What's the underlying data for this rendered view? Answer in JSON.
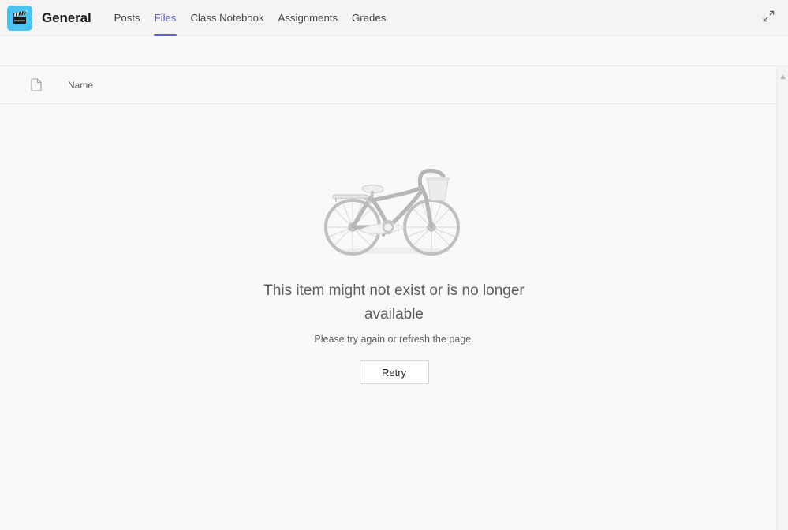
{
  "header": {
    "team_avatar_icon": "clapperboard-icon",
    "team_avatar_color": "#4cc2f1",
    "title": "General",
    "expand_icon": "expand-diagonal-arrows-icon",
    "accent_color": "#5b5fc7",
    "tabs": [
      {
        "label": "Posts",
        "active": false
      },
      {
        "label": "Files",
        "active": true
      },
      {
        "label": "Class Notebook",
        "active": false
      },
      {
        "label": "Assignments",
        "active": false
      },
      {
        "label": "Grades",
        "active": false
      }
    ]
  },
  "file_list": {
    "columns": {
      "type_icon": "document-icon",
      "name_label": "Name"
    }
  },
  "empty_state": {
    "illustration": "bicycle-illustration",
    "title": "This item might not exist or is no longer available",
    "subtitle": "Please try again or refresh the page.",
    "retry_label": "Retry"
  },
  "scrollbar": {
    "up_arrow_icon": "scroll-up-arrow-icon"
  }
}
